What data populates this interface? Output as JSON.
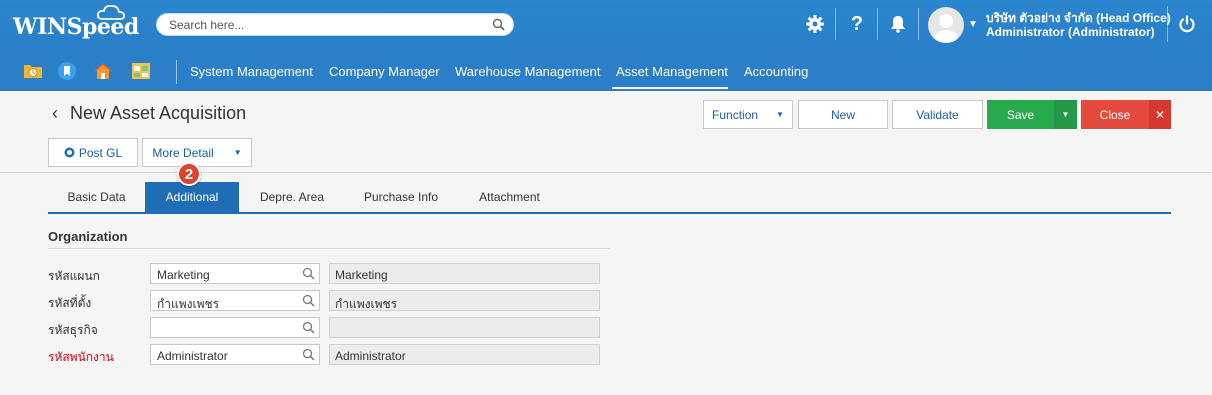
{
  "header": {
    "logo": "WINSpeed",
    "search_placeholder": "Search here...",
    "company": "บริษัท ตัวอย่าง จำกัด (Head Office)",
    "user": "Administrator (Administrator)"
  },
  "nav": {
    "items": [
      "System Management",
      "Company Manager",
      "Warehouse Management",
      "Asset Management",
      "Accounting"
    ],
    "active": "Asset Management"
  },
  "page": {
    "title": "New Asset Acquisition",
    "buttons": {
      "function": "Function",
      "new": "New",
      "validate": "Validate",
      "save": "Save",
      "close": "Close",
      "post_gl": "Post GL",
      "more_detail": "More Detail"
    }
  },
  "tabs": [
    "Basic Data",
    "Additional",
    "Depre. Area",
    "Purchase Info",
    "Attachment"
  ],
  "active_tab": "Additional",
  "step_badge": "2",
  "section": {
    "title": "Organization",
    "fields": [
      {
        "label": "รหัสแผนก",
        "value": "Marketing",
        "display": "Marketing",
        "required": false
      },
      {
        "label": "รหัสที่ตั้ง",
        "value": "กำแพงเพชร",
        "display": "กำแพงเพชร",
        "required": false
      },
      {
        "label": "รหัสธุรกิจ",
        "value": "",
        "display": "",
        "required": false
      },
      {
        "label": "รหัสพนักงาน",
        "value": "Administrator",
        "display": "Administrator",
        "required": true
      }
    ]
  },
  "colors": {
    "header_blue": "#2a7fc8",
    "tab_active": "#1f6db5",
    "save_green": "#27a94d",
    "close_red": "#e44b3d",
    "required_red": "#d9001b"
  }
}
